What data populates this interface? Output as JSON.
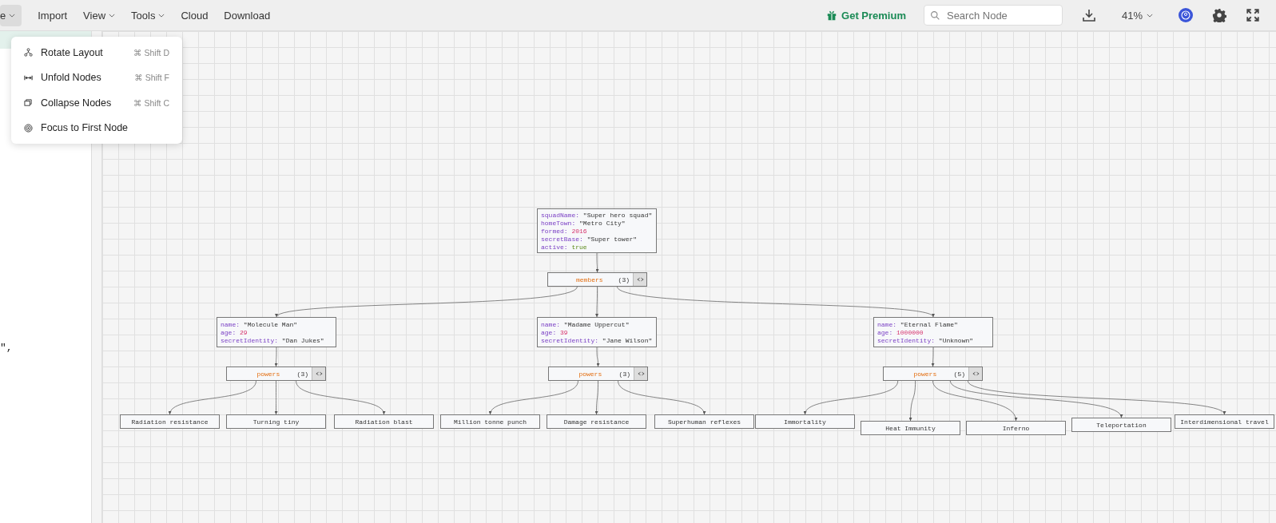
{
  "toolbar": {
    "menus": [
      {
        "label": "e",
        "has_caret": true,
        "selected": true
      },
      {
        "label": "Import",
        "has_caret": false,
        "selected": false
      },
      {
        "label": "View",
        "has_caret": true,
        "selected": false
      },
      {
        "label": "Tools",
        "has_caret": true,
        "selected": false
      },
      {
        "label": "Cloud",
        "has_caret": false,
        "selected": false
      },
      {
        "label": "Download",
        "has_caret": false,
        "selected": false
      }
    ],
    "premium": "Get Premium",
    "search": {
      "placeholder": "Search Node"
    },
    "zoom": "41%"
  },
  "menu": {
    "items": [
      {
        "label": "Rotate Layout",
        "shortcut": "⌘ Shift D"
      },
      {
        "label": "Unfold Nodes",
        "shortcut": "⌘ Shift F"
      },
      {
        "label": "Collapse Nodes",
        "shortcut": "⌘ Shift C"
      },
      {
        "label": "Focus to First Node"
      }
    ]
  },
  "editor": {
    "fragment": "\","
  },
  "graph": {
    "root": {
      "fields": [
        {
          "key": "squadName:",
          "value": "\"Super hero squad\"",
          "kind": "string"
        },
        {
          "key": "homeTown:",
          "value": "\"Metro City\"",
          "kind": "string"
        },
        {
          "key": "formed:",
          "value": "2016",
          "kind": "number"
        },
        {
          "key": "secretBase:",
          "value": "\"Super tower\"",
          "kind": "string"
        },
        {
          "key": "active:",
          "value": "true",
          "kind": "boolean"
        }
      ],
      "children": [
        {
          "key": "members",
          "count": "(3)",
          "children": [
            {
              "fields": [
                {
                  "key": "name:",
                  "value": "\"Molecule Man\"",
                  "kind": "string"
                },
                {
                  "key": "age:",
                  "value": "29",
                  "kind": "number"
                },
                {
                  "key": "secretIdentity:",
                  "value": "\"Dan Jukes\"",
                  "kind": "string"
                }
              ],
              "children": [
                {
                  "key": "powers",
                  "count": "(3)",
                  "children": [
                    "Radiation resistance",
                    "Turning tiny",
                    "Radiation blast"
                  ]
                }
              ]
            },
            {
              "fields": [
                {
                  "key": "name:",
                  "value": "\"Madame Uppercut\"",
                  "kind": "string"
                },
                {
                  "key": "age:",
                  "value": "39",
                  "kind": "number"
                },
                {
                  "key": "secretIdentity:",
                  "value": "\"Jane Wilson\"",
                  "kind": "string"
                }
              ],
              "children": [
                {
                  "key": "powers",
                  "count": "(3)",
                  "children": [
                    "Million tonne punch",
                    "Damage resistance",
                    "Superhuman reflexes"
                  ]
                }
              ]
            },
            {
              "fields": [
                {
                  "key": "name:",
                  "value": "\"Eternal Flame\"",
                  "kind": "string"
                },
                {
                  "key": "age:",
                  "value": "1000000",
                  "kind": "number"
                },
                {
                  "key": "secretIdentity:",
                  "value": "\"Unknown\"",
                  "kind": "string"
                }
              ],
              "children": [
                {
                  "key": "powers",
                  "count": "(5)",
                  "children": [
                    "Immortality",
                    "Heat Immunity",
                    "Inferno",
                    "Teleportation",
                    "Interdimensional travel"
                  ]
                }
              ]
            }
          ]
        }
      ]
    }
  }
}
